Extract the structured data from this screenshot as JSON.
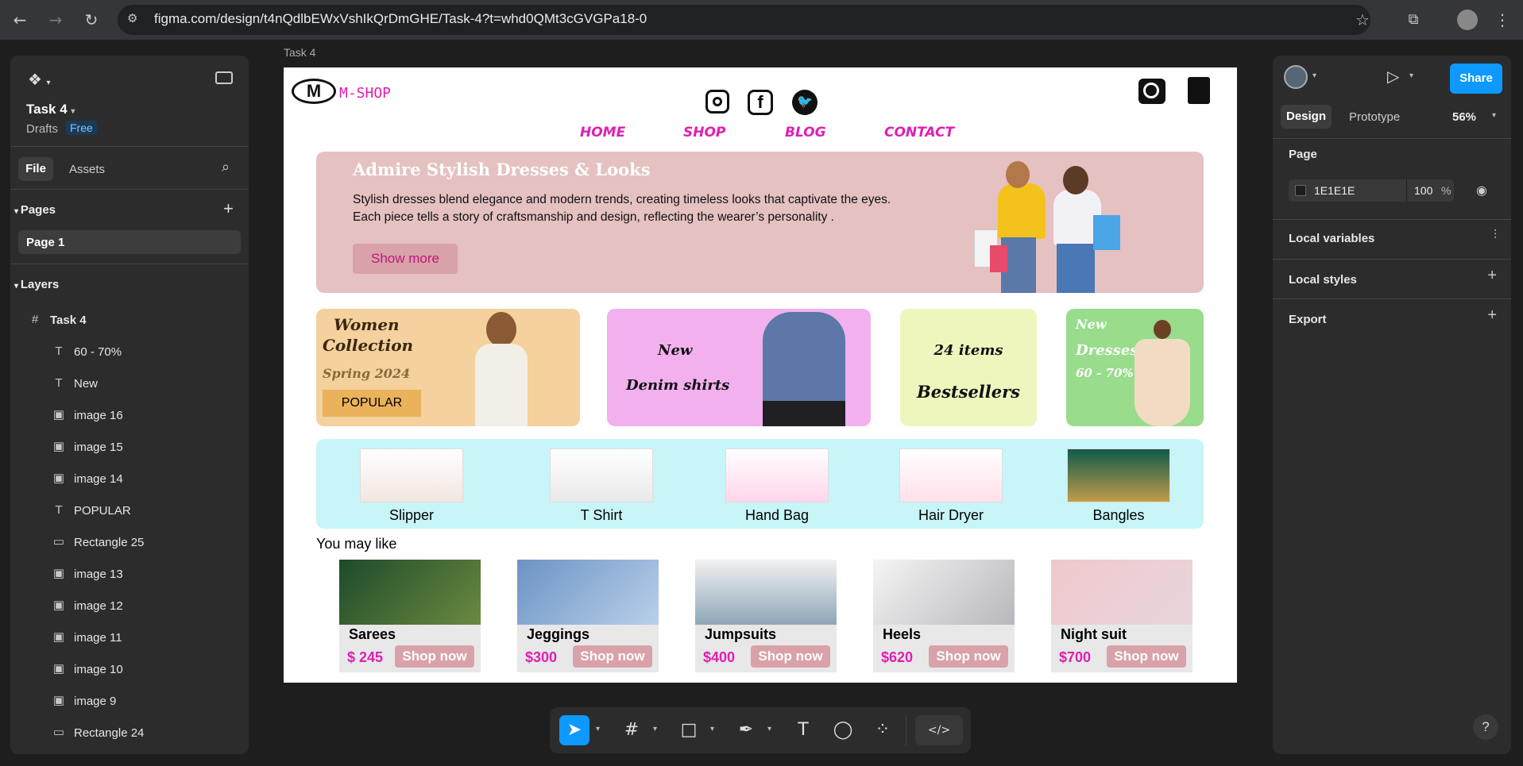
{
  "browser": {
    "url": "figma.com/design/t4nQdlbEWxVshIkQrDmGHE/Task-4?t=whd0QMt3cGVGPa18-0"
  },
  "file": {
    "name": "Task 4",
    "location": "Drafts",
    "plan": "Free"
  },
  "left_tabs": [
    "File",
    "Assets"
  ],
  "pages_title": "Pages",
  "pages": [
    "Page 1"
  ],
  "layers_title": "Layers",
  "layers": [
    {
      "icon": "frame-icon",
      "label": "Task 4"
    },
    {
      "icon": "text-icon",
      "label": "60 - 70%"
    },
    {
      "icon": "text-icon",
      "label": "New"
    },
    {
      "icon": "image-icon",
      "label": "image 16"
    },
    {
      "icon": "image-icon",
      "label": "image 15"
    },
    {
      "icon": "image-icon",
      "label": "image 14"
    },
    {
      "icon": "text-icon",
      "label": "POPULAR"
    },
    {
      "icon": "rectangle-icon",
      "label": "Rectangle 25"
    },
    {
      "icon": "image-icon",
      "label": "image 13"
    },
    {
      "icon": "image-icon",
      "label": "image 12"
    },
    {
      "icon": "image-icon",
      "label": "image 11"
    },
    {
      "icon": "image-icon",
      "label": "image 10"
    },
    {
      "icon": "image-icon",
      "label": "image 9"
    },
    {
      "icon": "rectangle-icon",
      "label": "Rectangle 24"
    }
  ],
  "canvas_label": "Task 4",
  "design": {
    "brand": "M-SHOP",
    "nav": [
      "HOME",
      "SHOP",
      "BLOG",
      "CONTACT"
    ],
    "hero": {
      "title": "Admire Stylish Dresses & Looks",
      "line1": "Stylish dresses blend elegance and modern trends, creating timeless looks that captivate the eyes.",
      "line2": "Each piece tells a story of craftsmanship and design, reflecting the wearer’s personality .",
      "button": "Show more"
    },
    "promo": {
      "women": {
        "line1": "Women",
        "line2": "Collection",
        "season": "Spring 2024",
        "tag": "POPULAR"
      },
      "denim": {
        "line1": "New",
        "line2": "Denim shirts"
      },
      "best": {
        "line1": "24 items",
        "line2": "Bestsellers"
      },
      "dresses": {
        "line1": "New",
        "line2": "Dresses",
        "line3": "60 - 70%"
      }
    },
    "categories": [
      "Slipper",
      "T Shirt",
      "Hand Bag",
      "Hair Dryer",
      "Bangles"
    ],
    "you_may_like": "You may like",
    "products": [
      {
        "name": "Sarees",
        "price": "$ 245",
        "cta": "Shop now"
      },
      {
        "name": "Jeggings",
        "price": "$300",
        "cta": "Shop now"
      },
      {
        "name": "Jumpsuits",
        "price": "$400",
        "cta": "Shop now"
      },
      {
        "name": "Heels",
        "price": "$620",
        "cta": "Shop now"
      },
      {
        "name": "Night suit",
        "price": "$700",
        "cta": "Shop now"
      }
    ]
  },
  "right": {
    "tabs": [
      "Design",
      "Prototype"
    ],
    "zoom": "56%",
    "share": "Share",
    "page_title": "Page",
    "page_color": "1E1E1E",
    "page_opacity": "100",
    "percent": "%",
    "sections": [
      "Local variables",
      "Local styles",
      "Export"
    ]
  },
  "colors": {
    "accent": "#0d99ff",
    "brand_pink": "#e01fb2"
  }
}
